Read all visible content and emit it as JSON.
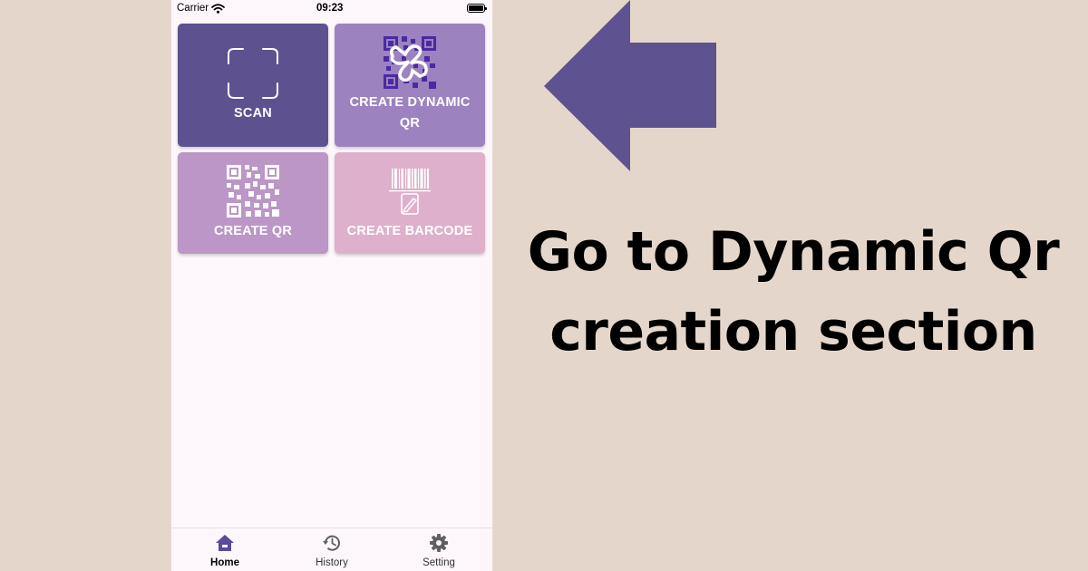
{
  "status_bar": {
    "carrier": "Carrier",
    "time": "09:23"
  },
  "tiles": {
    "scan": {
      "label": "SCAN",
      "icon": "scan-frame-icon",
      "color": "#5e518f"
    },
    "create_dynamic_qr": {
      "label_line1": "CREATE DYNAMIC",
      "label_line2": "QR",
      "icon": "dynamic-qr-icon",
      "color": "#9d82c0"
    },
    "create_qr": {
      "label": "CREATE QR",
      "icon": "qr-code-icon",
      "color": "#bb96c6"
    },
    "create_barcode": {
      "label": "CREATE BARCODE",
      "icon": "barcode-icon",
      "color": "#dfb0cb"
    }
  },
  "tabbar": {
    "items": [
      {
        "label": "Home",
        "icon": "home-icon",
        "active": true
      },
      {
        "label": "History",
        "icon": "history-icon",
        "active": false
      },
      {
        "label": "Setting",
        "icon": "gear-icon",
        "active": false
      }
    ],
    "active_color": "#5a4a99"
  },
  "annotation": {
    "line1": "Go to Dynamic Qr",
    "line2": "creation section",
    "arrow_color": "#5e5290",
    "arrow_icon": "left-arrow-icon"
  }
}
